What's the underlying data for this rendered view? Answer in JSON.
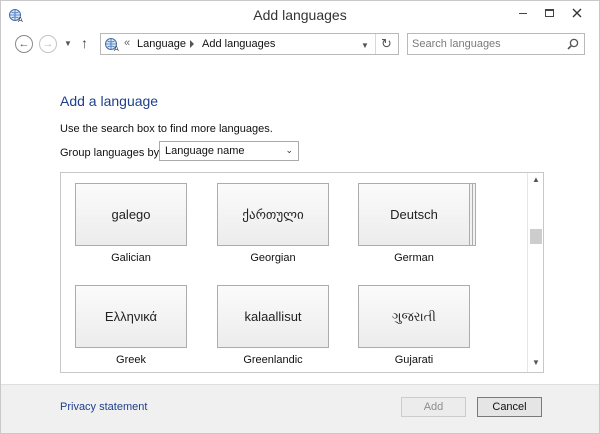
{
  "window": {
    "title": "Add languages",
    "icon": "language-icon"
  },
  "nav": {
    "breadcrumb_sep": "«",
    "crumbs": [
      "Language",
      "Add languages"
    ],
    "search_placeholder": "Search languages"
  },
  "content": {
    "heading": "Add a language",
    "instruction": "Use the search box to find more languages.",
    "group_label": "Group languages by:",
    "group_value": "Language name"
  },
  "languages": [
    {
      "native": "galego",
      "name": "Galician"
    },
    {
      "native": "ქართული",
      "name": "Georgian"
    },
    {
      "native": "Deutsch",
      "name": "German"
    },
    {
      "native": "Ελληνικά",
      "name": "Greek"
    },
    {
      "native": "kalaallisut",
      "name": "Greenlandic"
    },
    {
      "native": "ગુજરાતી",
      "name": "Gujarati"
    }
  ],
  "footer": {
    "privacy": "Privacy statement",
    "add_label": "Add",
    "cancel_label": "Cancel"
  }
}
